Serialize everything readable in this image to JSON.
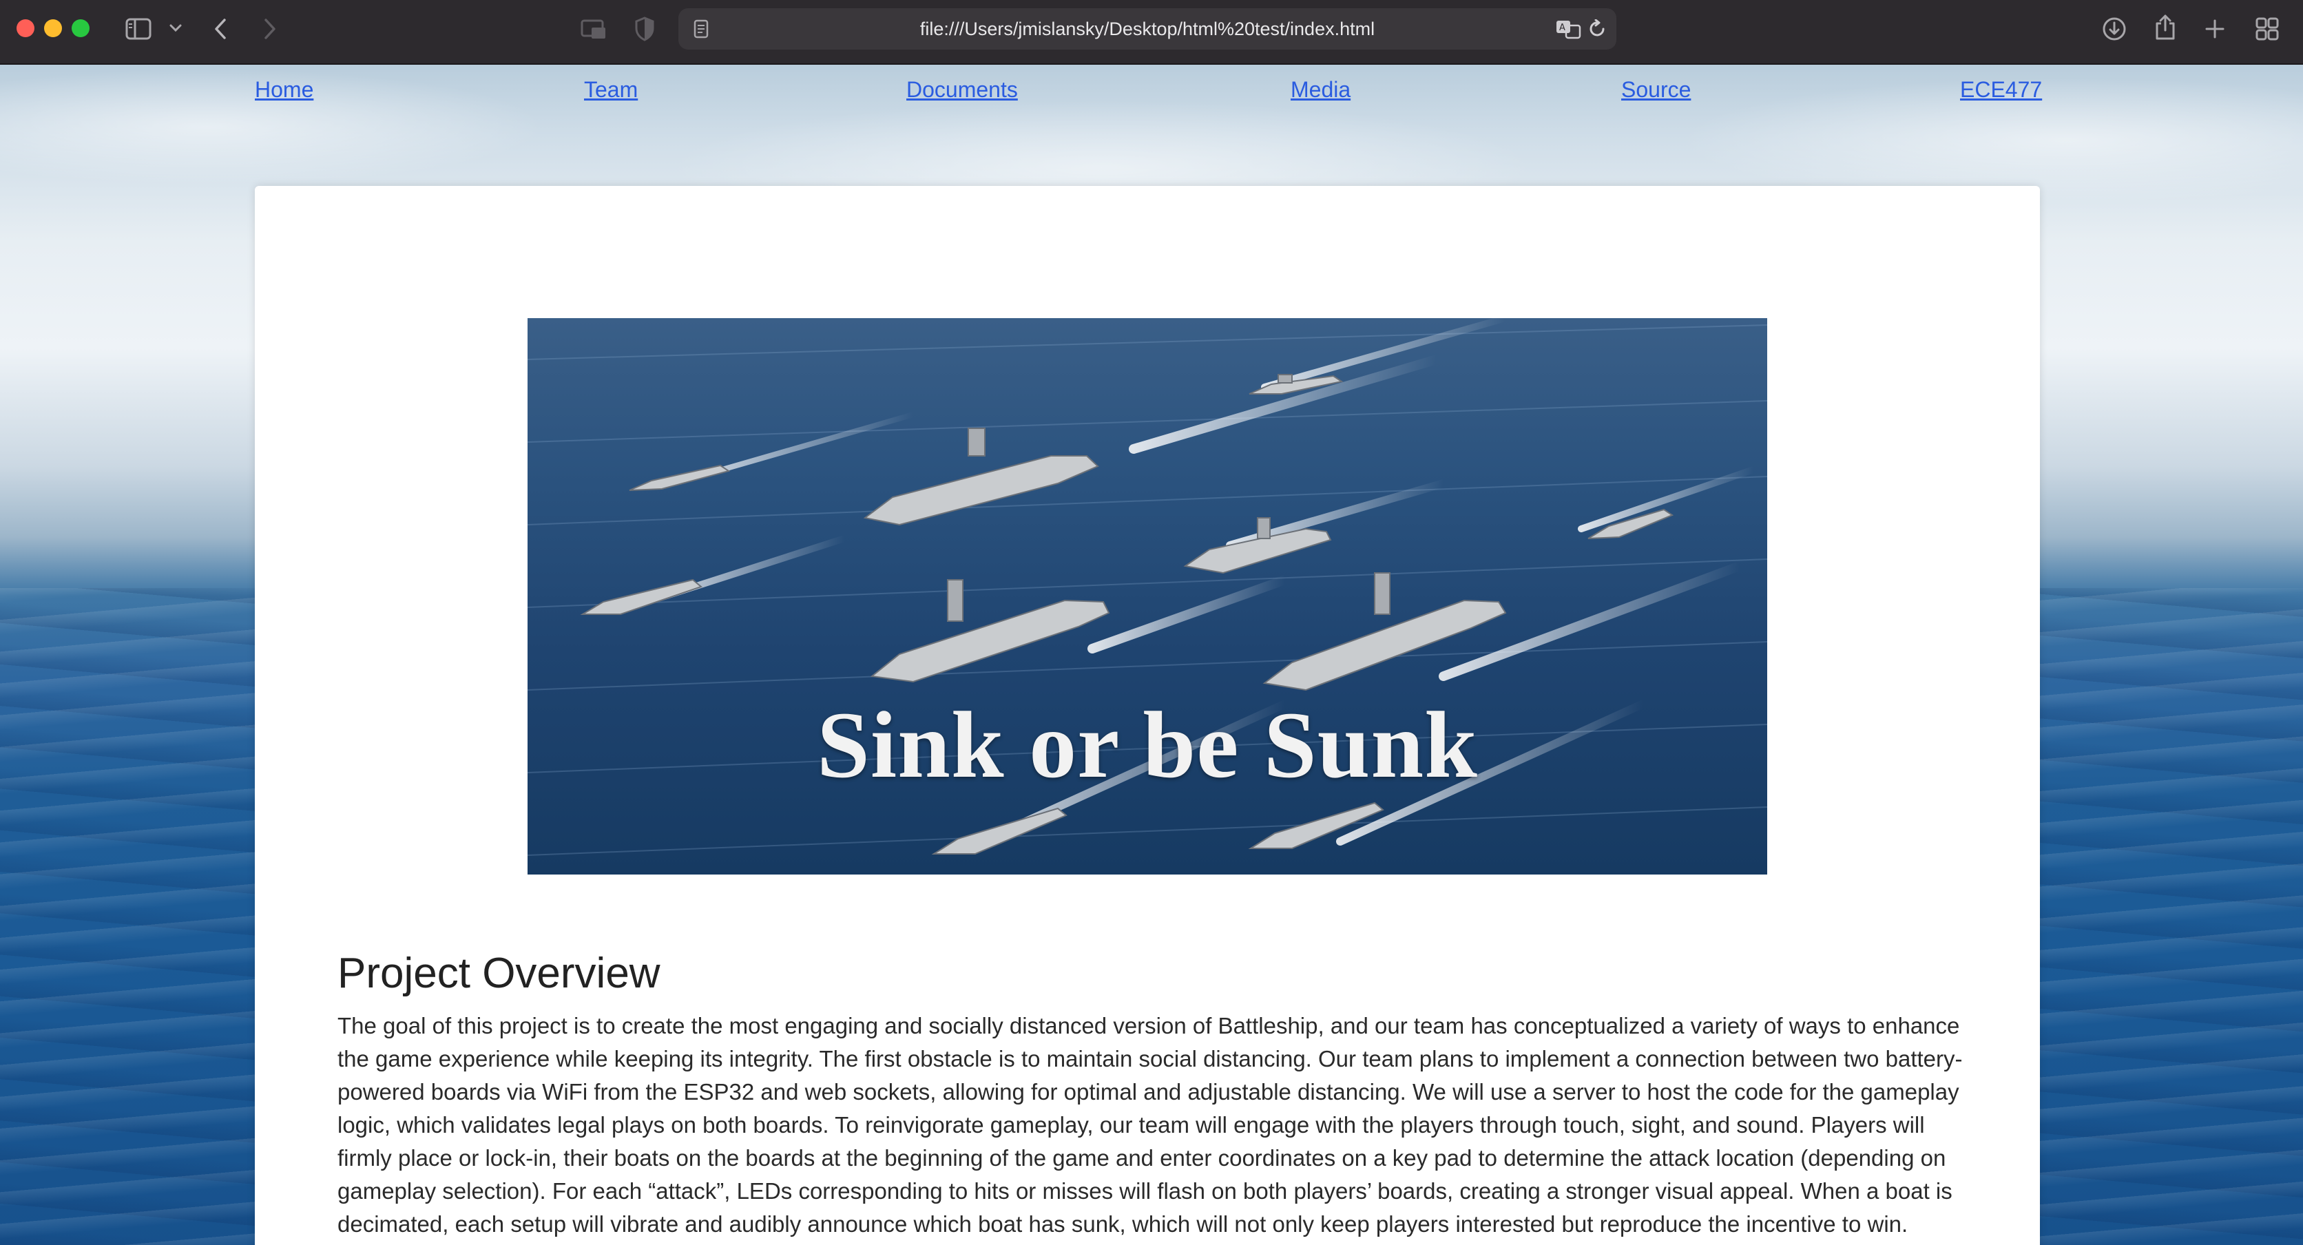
{
  "browser": {
    "url": "file:///Users/jmislansky/Desktop/html%20test/index.html",
    "icons": {
      "sidebar": "sidebar-icon",
      "back": "chevron-left-icon",
      "forward": "chevron-right-icon",
      "translate": "translate-icon",
      "reload": "reload-icon",
      "download": "download-icon",
      "share": "share-icon",
      "new_tab": "plus-icon",
      "tab_overview": "tab-grid-icon"
    }
  },
  "nav": {
    "items": [
      "Home",
      "Team",
      "Documents",
      "Media",
      "Source",
      "ECE477"
    ]
  },
  "hero": {
    "title": "Sink or be Sunk"
  },
  "overview": {
    "heading": "Project Overview",
    "text": "The goal of this project is to create the most engaging and socially distanced version of Battleship, and our team has conceptualized a variety of ways to enhance the game experience while keeping its integrity. The first obstacle is to maintain social distancing. Our team plans to implement a connection between two battery-powered boards via WiFi from the ESP32 and web sockets, allowing for optimal and adjustable distancing. We will use a server to host the code for the gameplay logic, which validates legal plays on both boards. To reinvigorate gameplay, our team will engage with the players through touch, sight, and sound. Players will firmly place or lock-in, their boats on the boards at the beginning of the game and enter coordinates on a key pad to determine the attack location (depending on gameplay selection). For each “attack”, LEDs corresponding to hits or misses will flash on both players’ boards, creating a stronger visual appeal. When a boat is decimated, each setup will vibrate and audibly announce which boat has sunk, which will not only keep players interested but reproduce the incentive to win."
  },
  "colors": {
    "link": "#2a5ce0",
    "toolbar": "#2d2a2e",
    "traffic_red": "#ff5f57",
    "traffic_yellow": "#febc2e",
    "traffic_green": "#28c840"
  }
}
